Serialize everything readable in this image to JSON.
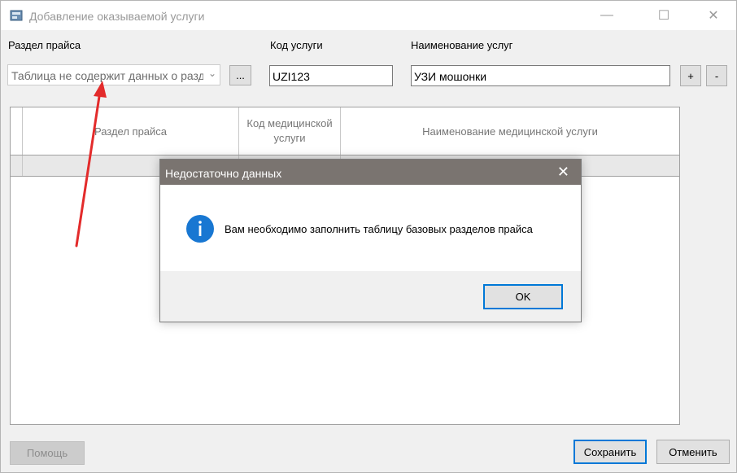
{
  "window": {
    "title": "Добавление оказываемой услуги",
    "minimize_glyph": "—",
    "maximize_glyph": "☐",
    "close_glyph": "✕"
  },
  "form": {
    "section_label": "Раздел прайса",
    "section_value": "Таблица не содержит данных о разделах",
    "browse_label": "...",
    "code_label": "Код услуги",
    "code_value": "UZI123",
    "name_label": "Наименование услуг",
    "name_value": "УЗИ мошонки",
    "add_label": "+",
    "remove_label": "-"
  },
  "grid": {
    "columns": [
      "Раздел прайса",
      "Код медицинской услуги",
      "Наименование медицинской услуги"
    ]
  },
  "dialog": {
    "title": "Недостаточно данных",
    "close_glyph": "✕",
    "message": "Вам необходимо заполнить таблицу базовых разделов прайса",
    "ok_label": "OK"
  },
  "footer": {
    "help_label": "Помощь",
    "save_label": "Сохранить",
    "cancel_label": "Отменить"
  },
  "colors": {
    "annotation_arrow": "#e32b2b",
    "info_icon": "#1877d2",
    "dialog_titlebar": "#7a7470"
  }
}
